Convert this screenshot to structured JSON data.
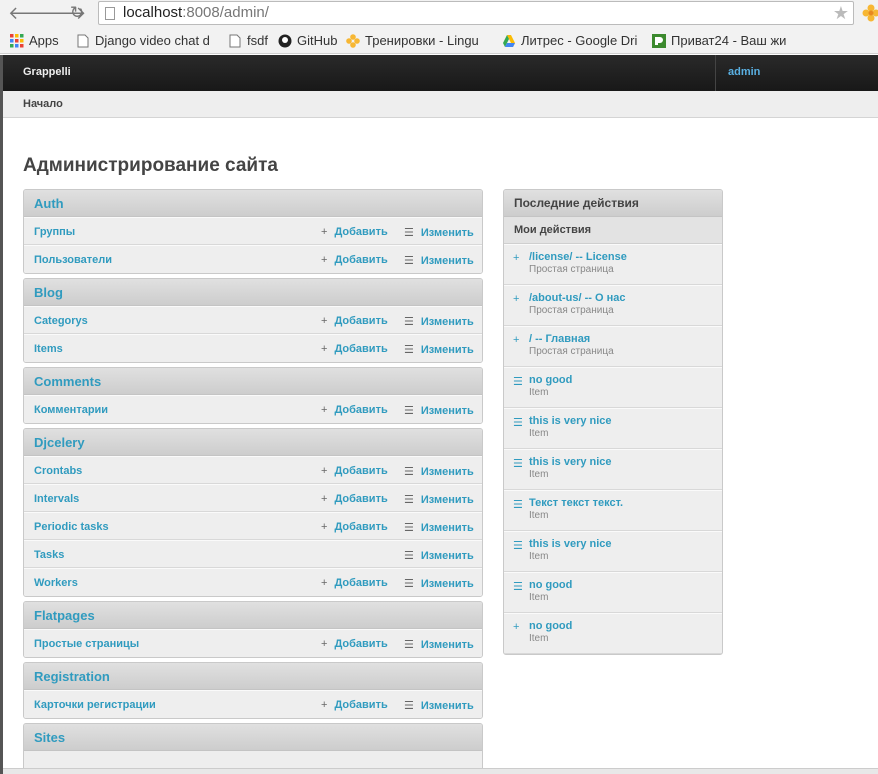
{
  "browser": {
    "url_host": "localhost",
    "url_rest": ":8008/admin/",
    "bookmarks": [
      {
        "label": "Apps",
        "icon": "apps-grid-icon"
      },
      {
        "label": "Django video chat d",
        "icon": "page-icon"
      },
      {
        "label": "fsdf",
        "icon": "page-icon"
      },
      {
        "label": "GitHub",
        "icon": "github-icon"
      },
      {
        "label": "Тренировки - Lingu",
        "icon": "flower-icon"
      },
      {
        "label": "Литрес - Google Dri",
        "icon": "drive-icon"
      },
      {
        "label": "Приват24 - Ваш жи",
        "icon": "privat-icon"
      }
    ]
  },
  "header": {
    "brand": "Grappelli",
    "user": "admin"
  },
  "breadcrumb": "Начало",
  "page_title": "Администрирование сайта",
  "actions": {
    "add": "Добавить",
    "change": "Изменить"
  },
  "modules": [
    {
      "title": "Auth",
      "models": [
        {
          "name": "Группы",
          "add": true
        },
        {
          "name": "Пользователи",
          "add": true
        }
      ]
    },
    {
      "title": "Blog",
      "models": [
        {
          "name": "Categorys",
          "add": true
        },
        {
          "name": "Items",
          "add": true
        }
      ]
    },
    {
      "title": "Comments",
      "models": [
        {
          "name": "Комментарии",
          "add": true
        }
      ]
    },
    {
      "title": "Djcelery",
      "models": [
        {
          "name": "Crontabs",
          "add": true
        },
        {
          "name": "Intervals",
          "add": true
        },
        {
          "name": "Periodic tasks",
          "add": true
        },
        {
          "name": "Tasks",
          "add": false
        },
        {
          "name": "Workers",
          "add": true
        }
      ]
    },
    {
      "title": "Flatpages",
      "models": [
        {
          "name": "Простые страницы",
          "add": true
        }
      ]
    },
    {
      "title": "Registration",
      "models": [
        {
          "name": "Карточки регистрации",
          "add": true
        }
      ]
    },
    {
      "title": "Sites",
      "models": []
    }
  ],
  "recent_actions": {
    "title": "Последние действия",
    "subtitle": "Мои действия",
    "items": [
      {
        "action": "add",
        "title": "/license/ -- License",
        "type": "Простая страница"
      },
      {
        "action": "add",
        "title": "/about-us/ -- О нас",
        "type": "Простая страница"
      },
      {
        "action": "add",
        "title": "/ -- Главная",
        "type": "Простая страница"
      },
      {
        "action": "change",
        "title": "no good",
        "type": "Item"
      },
      {
        "action": "change",
        "title": "this is very nice",
        "type": "Item"
      },
      {
        "action": "change",
        "title": "this is very nice",
        "type": "Item"
      },
      {
        "action": "change",
        "title": "Текст текст текст.",
        "type": "Item"
      },
      {
        "action": "change",
        "title": "this is very nice",
        "type": "Item"
      },
      {
        "action": "change",
        "title": "no good",
        "type": "Item"
      },
      {
        "action": "add",
        "title": "no good",
        "type": "Item"
      }
    ]
  }
}
